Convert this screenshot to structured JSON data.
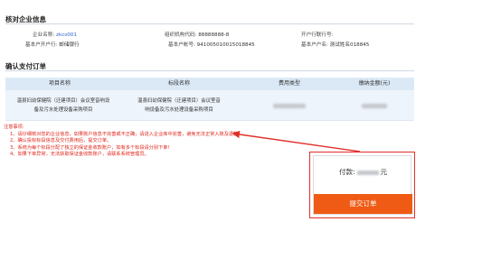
{
  "company_section": {
    "title": "核对企业信息",
    "row1": [
      {
        "label": "企业名称:",
        "value": "zkcs001"
      },
      {
        "label": "组织机构代码:",
        "value": "88888888-8"
      },
      {
        "label": "开户行联行号:",
        "value": ""
      }
    ],
    "row2": [
      {
        "label": "基本户开户行:",
        "value": "邮储银行"
      },
      {
        "label": "基本户帐号:",
        "value": "941005010015018845"
      },
      {
        "label": "基本户户名:",
        "value": "测试姓名018845"
      }
    ]
  },
  "order_section": {
    "title": "确认支付订单",
    "columns": [
      "项目名称",
      "标段名称",
      "费用类型",
      "缴纳金额(元)"
    ],
    "row": {
      "project_line1": "温县妇幼保健院（迁建项目）会议室音响设",
      "project_line2": "备及污水处理设备采购项目",
      "section_line1": "温县妇幼保健院（迁建项目）会议室音",
      "section_line2": "响设备及污水处理设备采购项目"
    }
  },
  "notice": {
    "heading": "注意事项:",
    "items": [
      "1、请仔细核对您的企业信息，如果账户信息不完善或不正确，请进入企业库中完善，避免无法正常入账及退款!",
      "2、确认投标标段信息及交付费用后，提交订单。",
      "3、系统为每个标段分配了独立的保证金收款账户，如有多个标段请分别下单!",
      "4、如果下单异常，无法获取保证金收款账户，请联系系统管理员。"
    ]
  },
  "payment": {
    "label": "付款:",
    "unit": "元",
    "submit_label": "提交订单"
  },
  "colors": {
    "accent": "#ef5b14",
    "notice_red": "#e0261c",
    "header_bg": "#dbe9f7",
    "row_bg": "#eef4fb",
    "link_blue": "#2b63c9"
  }
}
